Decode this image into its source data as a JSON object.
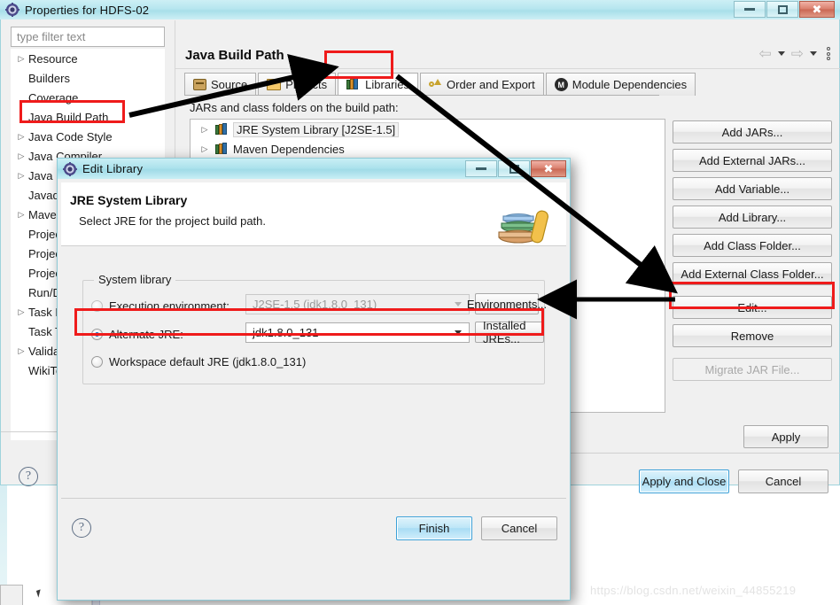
{
  "properties_window": {
    "title": "Properties for HDFS-02",
    "title_icon": "eclipse-gear-icon",
    "window_controls": {
      "minimize": "minimize-icon",
      "maximize": "maximize-icon",
      "close": "close-icon"
    },
    "filter": {
      "placeholder": "type filter text",
      "value": ""
    },
    "tree_items": [
      {
        "label": "Resource",
        "expandable": true,
        "selected": false
      },
      {
        "label": "Builders",
        "expandable": false,
        "selected": false
      },
      {
        "label": "Coverage",
        "expandable": false,
        "selected": false
      },
      {
        "label": "Java Build Path",
        "expandable": false,
        "selected": true
      },
      {
        "label": "Java Code Style",
        "expandable": true,
        "selected": false
      },
      {
        "label": "Java Compiler",
        "expandable": true,
        "selected": false
      },
      {
        "label": "Java Editor",
        "expandable": true,
        "selected": false
      },
      {
        "label": "Javadoc Location",
        "expandable": false,
        "selected": false
      },
      {
        "label": "Maven",
        "expandable": true,
        "selected": false
      },
      {
        "label": "Project Facets",
        "expandable": false,
        "selected": false
      },
      {
        "label": "Project Natures",
        "expandable": false,
        "selected": false
      },
      {
        "label": "Project References",
        "expandable": false,
        "selected": false
      },
      {
        "label": "Run/Debug Settings",
        "expandable": false,
        "selected": false
      },
      {
        "label": "Task Repository",
        "expandable": true,
        "selected": false
      },
      {
        "label": "Task Tags",
        "expandable": false,
        "selected": false
      },
      {
        "label": "Validation",
        "expandable": true,
        "selected": false
      },
      {
        "label": "WikiText",
        "expandable": false,
        "selected": false
      }
    ],
    "page_title": "Java Build Path",
    "nav": {
      "back": "back-arrow-icon",
      "forward": "forward-arrow-icon",
      "menu": "view-menu-icon"
    },
    "tabs": [
      {
        "label": "Source",
        "icon": "source-folder-icon",
        "active": false
      },
      {
        "label": "Projects",
        "icon": "projects-folder-icon",
        "active": false
      },
      {
        "label": "Libraries",
        "icon": "libraries-books-icon",
        "active": true
      },
      {
        "label": "Order and Export",
        "icon": "order-export-icon",
        "active": false
      },
      {
        "label": "Module Dependencies",
        "icon": "module-dependencies-icon",
        "active": false
      }
    ],
    "hint": "JARs and class folders on the build path:",
    "list_items": [
      {
        "label": "JRE System Library [J2SE-1.5]",
        "icon": "libraries-books-icon",
        "selected": true
      },
      {
        "label": "Maven Dependencies",
        "icon": "libraries-books-icon",
        "selected": false
      }
    ],
    "side_buttons": [
      {
        "label": "Add JARs...",
        "enabled": true
      },
      {
        "label": "Add External JARs...",
        "enabled": true
      },
      {
        "label": "Add Variable...",
        "enabled": true
      },
      {
        "label": "Add Library...",
        "enabled": true
      },
      {
        "label": "Add Class Folder...",
        "enabled": true
      },
      {
        "label": "Add External Class Folder...",
        "enabled": true
      },
      {
        "label": "Edit...",
        "enabled": true
      },
      {
        "label": "Remove",
        "enabled": true
      },
      {
        "label": "Migrate JAR File...",
        "enabled": false
      }
    ],
    "apply_label": "Apply",
    "apply_and_close_label": "Apply and Close",
    "cancel_label": "Cancel",
    "help_icon": "help-question-icon"
  },
  "edit_library_dialog": {
    "title": "Edit Library",
    "title_icon": "eclipse-gear-icon",
    "window_controls": {
      "minimize": "minimize-icon",
      "maximize": "maximize-icon",
      "close": "close-icon"
    },
    "heading": "JRE System Library",
    "subheading": "Select JRE for the project build path.",
    "banner_icon": "books-stack-icon",
    "group_legend": "System library",
    "options": [
      {
        "label": "Execution environment:",
        "selected": false,
        "enabled": false,
        "combo_value": "J2SE-1.5 (jdk1.8.0_131)",
        "button": "Environments..."
      },
      {
        "label": "Alternate JRE:",
        "selected": true,
        "enabled": true,
        "combo_value": "jdk1.8.0_131",
        "button": "Installed JREs..."
      },
      {
        "label": "Workspace default JRE (jdk1.8.0_131)",
        "selected": false,
        "enabled": true
      }
    ],
    "finish_label": "Finish",
    "cancel_label": "Cancel",
    "help_icon": "help-question-icon"
  },
  "annotations": {
    "highlight_color": "#ef1b1b",
    "arrow_color": "#000000",
    "highlighted_elements": [
      "sidebar-item-java-build-path",
      "tab-libraries",
      "edit-button",
      "alternate-jre-row"
    ]
  },
  "watermark": "https://blog.csdn.net/weixin_44855219"
}
